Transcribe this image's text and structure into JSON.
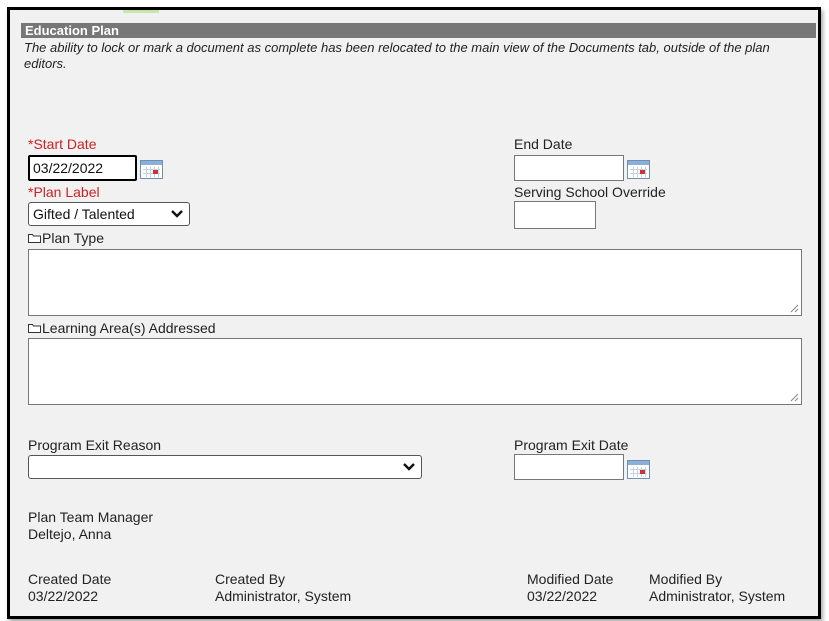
{
  "panel": {
    "title": "Education Plan",
    "notice": "The ability to lock or mark a document as complete has been relocated to the main view of the Documents tab, outside of the plan editors."
  },
  "fields": {
    "start_date": {
      "label": "*Start Date",
      "value": "03/22/2022"
    },
    "end_date": {
      "label": "End Date",
      "value": ""
    },
    "plan_label": {
      "label": "*Plan Label",
      "selected": "Gifted / Talented"
    },
    "serving_school_override": {
      "label": "Serving School Override",
      "value": ""
    },
    "plan_type": {
      "label": "Plan Type",
      "value": ""
    },
    "learning_areas": {
      "label": "Learning Area(s) Addressed",
      "value": ""
    },
    "program_exit_reason": {
      "label": "Program Exit Reason",
      "selected": ""
    },
    "program_exit_date": {
      "label": "Program Exit Date",
      "value": ""
    }
  },
  "info": {
    "plan_team_manager": {
      "label": "Plan Team Manager",
      "value": "Deltejo, Anna"
    },
    "created_date": {
      "label": "Created Date",
      "value": "03/22/2022"
    },
    "created_by": {
      "label": "Created By",
      "value": "Administrator, System"
    },
    "modified_date": {
      "label": "Modified Date",
      "value": "03/22/2022"
    },
    "modified_by": {
      "label": "Modified By",
      "value": "Administrator, System"
    }
  },
  "icons": {
    "calendar": "calendar-icon",
    "dropdown": "chevron-down-icon",
    "folder": "folder-icon",
    "resize": "resize-grip-icon"
  },
  "colors": {
    "header_bg": "#777777",
    "required_label": "#cc2222",
    "panel_bg": "#f1f1f1"
  }
}
